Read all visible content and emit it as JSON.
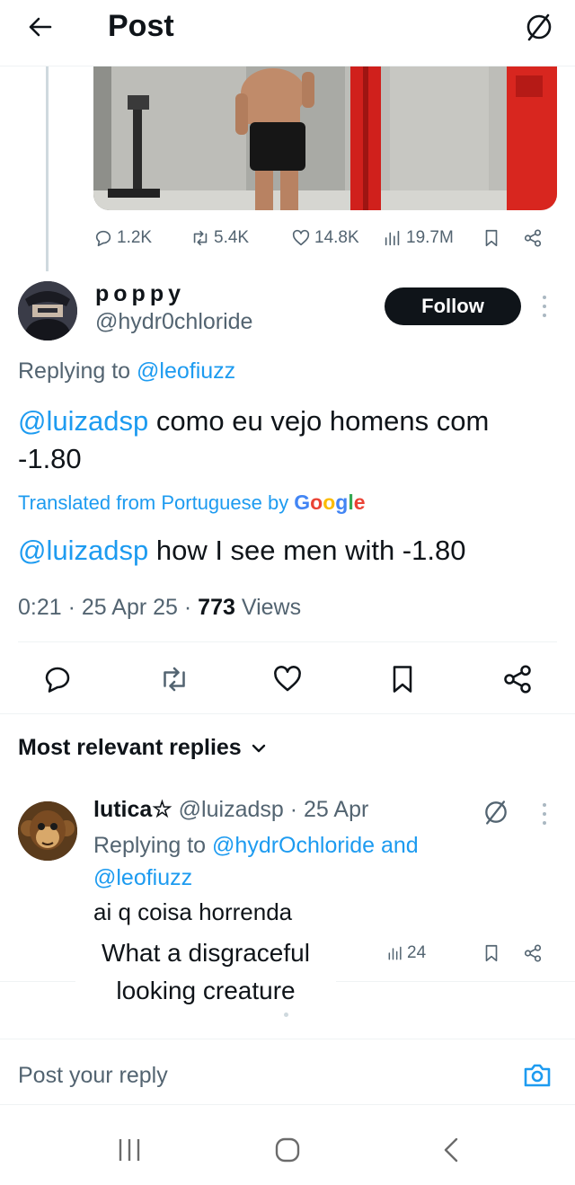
{
  "header": {
    "title": "Post",
    "back_icon": "arrow-left-icon",
    "grok_icon": "grok-icon"
  },
  "parent_post": {
    "stats": {
      "replies": "1.2K",
      "reposts": "5.4K",
      "likes": "14.8K",
      "views": "19.7M"
    }
  },
  "post": {
    "display_name": "poppy",
    "handle": "@hydr0chloride",
    "follow_label": "Follow",
    "replying_prefix": "Replying to",
    "replying_to": "@leofiuzz",
    "mention": "@luizadsp",
    "text": "como eu vejo homens com -1.80",
    "translated_label": "Translated from Portuguese by",
    "translated_brand": "Google",
    "translated_mention": "@luizadsp",
    "translated_text": "how I see men with -1.80",
    "time": "0:21",
    "date": "25 Apr 25",
    "views_count": "773",
    "views_label": "Views"
  },
  "replies_section": {
    "sort_label": "Most relevant replies"
  },
  "reply": {
    "display_name": "lutica☆",
    "handle": "@luizadsp",
    "date": "25 Apr",
    "replying_prefix": "Replying to",
    "replying_to_1": "@hydrOchloride",
    "replying_and": "and",
    "replying_to_2": "@leofiuzz",
    "text": "ai q coisa horrenda",
    "views": "24"
  },
  "caption_overlay": {
    "line1": "What a disgraceful",
    "line2": "looking creature"
  },
  "compose": {
    "placeholder": "Post your reply"
  },
  "colors": {
    "accent": "#1d9bf0",
    "text": "#0f1419",
    "secondary": "#536471"
  }
}
